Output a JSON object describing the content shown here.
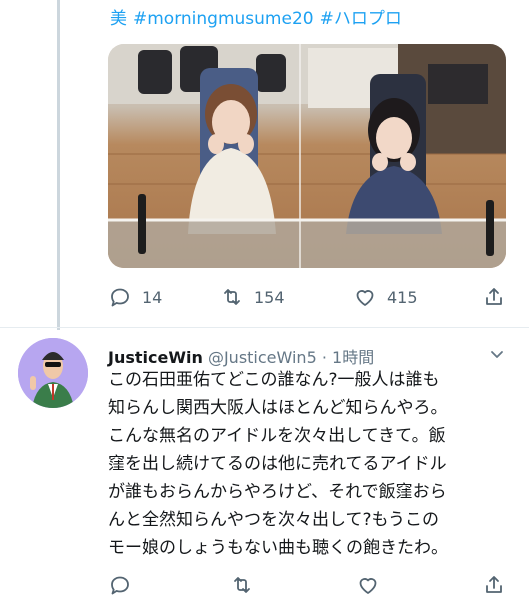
{
  "previous_tweet": {
    "hashtag_lead": "美",
    "hashtags": [
      "#morningmusume20",
      "#ハロプロ"
    ],
    "photo": {
      "description_icon": "studio-photo"
    },
    "actions": {
      "reply_count": "14",
      "retweet_count": "154",
      "like_count": "415"
    }
  },
  "reply_tweet": {
    "display_name": "JusticeWin",
    "handle": "@JusticeWin5",
    "separator": "·",
    "time": "1時間",
    "text_lines": [
      "この石田亜佑てどこの誰なん?一般人は誰も",
      "知らんし関西大阪人はほとんど知らんやろ。",
      "こんな無名のアイドルを次々出してきて。飯",
      "窪を出し続けてるのは他に売れてるアイドル",
      "が誰もおらんからやろけど、それで飯窪おら",
      "んと全然知らんやつを次々出して?もうこの",
      "モー娘のしょうもない曲も聴くの飽きたわ。"
    ]
  },
  "colors": {
    "link": "#1da1f2",
    "secondary_text": "#657786",
    "icon": "#536471",
    "thread_line": "#ccd6dd"
  }
}
